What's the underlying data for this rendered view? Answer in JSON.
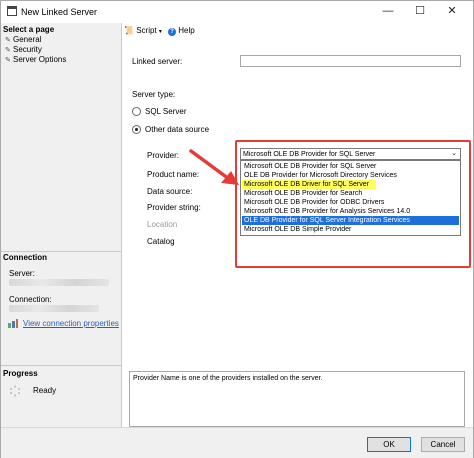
{
  "window": {
    "title": "New Linked Server",
    "minimize": "—",
    "maximize": "☐",
    "close": "✕"
  },
  "left": {
    "select_page": "Select a page",
    "pages": [
      "General",
      "Security",
      "Server Options"
    ],
    "connection_header": "Connection",
    "server_label": "Server:",
    "connection_label": "Connection:",
    "view_props": "View connection properties",
    "progress_header": "Progress",
    "progress_status": "Ready"
  },
  "toolbar": {
    "script": "Script",
    "help": "Help"
  },
  "form": {
    "linked_server_label": "Linked server:",
    "linked_server_value": "",
    "server_type_label": "Server type:",
    "sql_server": "SQL Server",
    "other_source": "Other data source",
    "provider_label": "Provider:",
    "product_name_label": "Product name:",
    "data_source_label": "Data source:",
    "provider_string_label": "Provider string:",
    "location_label": "Location",
    "catalog_label": "Catalog"
  },
  "provider_dropdown": {
    "selected": "Microsoft OLE DB Provider for SQL Server",
    "options": [
      "Microsoft OLE DB Provider for SQL Server",
      "OLE DB Provider for Microsoft Directory Services",
      "Microsoft OLE DB Driver for SQL Server",
      "Microsoft OLE DB Provider for Search",
      "Microsoft OLE DB Provider for ODBC Drivers",
      "Microsoft OLE DB Provider for Analysis Services 14.0",
      "OLE DB Provider for SQL Server Integration Services",
      "Microsoft OLE DB Simple Provider"
    ],
    "highlighted_index": 2,
    "selected_index": 6,
    "highlight_color": "#ffff5a",
    "selection_color": "#1e6fd9"
  },
  "description": "Provider Name is one of the providers installed on the server.",
  "buttons": {
    "ok": "OK",
    "cancel": "Cancel"
  },
  "accent": {
    "annotation_red": "#e43a3a"
  }
}
